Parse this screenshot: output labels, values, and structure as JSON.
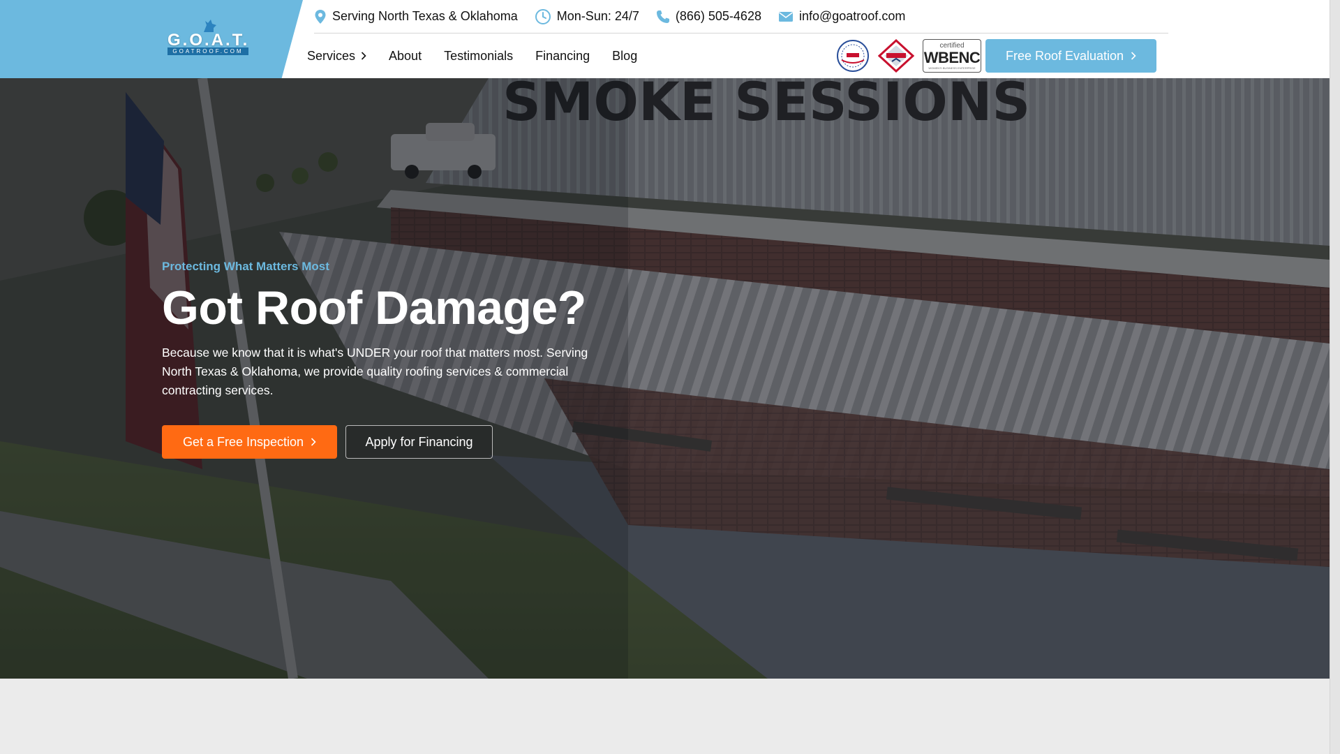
{
  "logo": {
    "main": "G.O.A.T.",
    "sub": "GOATROOF.COM"
  },
  "topbar": {
    "location": "Serving North Texas & Oklahoma",
    "hours": "Mon-Sun: 24/7",
    "phone": "(866) 505-4628",
    "email": "info@goatroof.com"
  },
  "nav": {
    "items": [
      {
        "label": "Services"
      },
      {
        "label": "About"
      },
      {
        "label": "Testimonials"
      },
      {
        "label": "Financing"
      },
      {
        "label": "Blog"
      }
    ]
  },
  "badges": {
    "wbenc_certified": "certified",
    "wbenc_main": "WBENC",
    "wbenc_small": "WOMEN'S BUSINESS ENTERPRISE"
  },
  "header_cta": {
    "label": "Free Roof Evaluation"
  },
  "hero": {
    "sign_text": "SMOKE SESSIONS",
    "eyebrow": "Protecting What Matters Most",
    "headline": "Got Roof Damage?",
    "lede": "Because we know that it is what's UNDER your roof that matters most. Serving North Texas & Oklahoma, we provide quality roofing services & commercial contracting services.",
    "primary_button": "Get a Free Inspection",
    "secondary_button": "Apply for Financing"
  },
  "colors": {
    "brand_blue": "#6cb9df",
    "accent_orange": "#ff6a13",
    "text_dark": "#111111"
  }
}
